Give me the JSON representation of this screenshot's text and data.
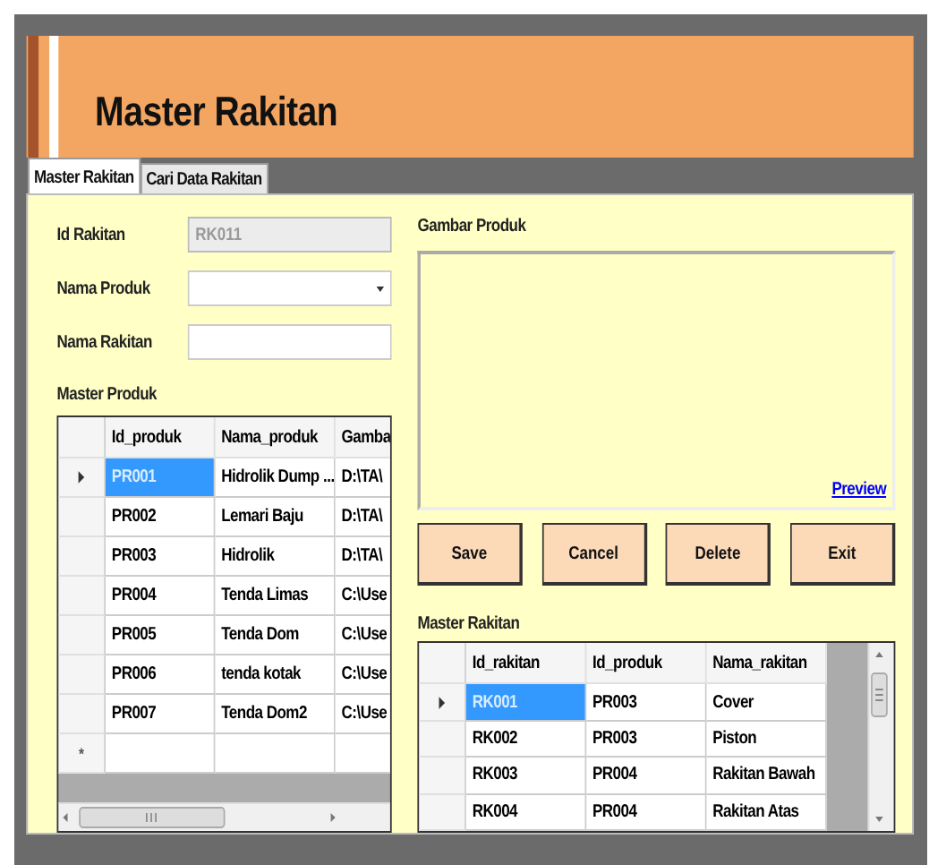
{
  "window": {
    "title": "Master Rakitan"
  },
  "tabs": [
    {
      "label": "Master Rakitan",
      "selected": true
    },
    {
      "label": "Cari Data Rakitan",
      "selected": false
    }
  ],
  "form": {
    "fields": [
      {
        "label": "Id Rakitan",
        "kind": "text",
        "value": "RK011",
        "disabled": true
      },
      {
        "label": "Nama Produk",
        "kind": "combo",
        "disabled": false
      },
      {
        "label": "Nama Rakitan",
        "kind": "text",
        "disabled": false
      }
    ]
  },
  "product_grid": {
    "title": "Master Produk",
    "columns": [
      "Id_produk",
      "Nama_produk",
      "Gamba"
    ],
    "new_row_marker": "*",
    "rows": [
      {
        "cells": [
          "PR001",
          "Hidrolik Dump ...",
          "D:\\TA\\"
        ],
        "selected": true
      },
      {
        "cells": [
          "PR002",
          "Lemari Baju",
          "D:\\TA\\"
        ],
        "selected": false
      },
      {
        "cells": [
          "PR003",
          "Hidrolik",
          "D:\\TA\\"
        ],
        "selected": false
      },
      {
        "cells": [
          "PR004",
          "Tenda Limas",
          "C:\\Use"
        ],
        "selected": false
      },
      {
        "cells": [
          "PR005",
          "Tenda Dom",
          "C:\\Use"
        ],
        "selected": false
      },
      {
        "cells": [
          "PR006",
          "tenda kotak",
          "C:\\Use"
        ],
        "selected": false
      },
      {
        "cells": [
          "PR007",
          "Tenda Dom2",
          "C:\\Use"
        ],
        "selected": false
      }
    ]
  },
  "image_panel": {
    "title": "Gambar Produk",
    "link": "Preview"
  },
  "buttons": [
    "Save",
    "Cancel",
    "Delete",
    "Exit"
  ],
  "assembly_grid": {
    "title": "Master Rakitan",
    "columns": [
      "Id_rakitan",
      "Id_produk",
      "Nama_rakitan"
    ],
    "rows": [
      {
        "cells": [
          "RK001",
          "PR003",
          "Cover"
        ],
        "selected": true
      },
      {
        "cells": [
          "RK002",
          "PR003",
          "Piston"
        ],
        "selected": false
      },
      {
        "cells": [
          "RK003",
          "PR004",
          "Rakitan Bawah"
        ],
        "selected": false
      },
      {
        "cells": [
          "RK004",
          "PR004",
          "Rakitan Atas"
        ],
        "selected": false
      }
    ]
  }
}
